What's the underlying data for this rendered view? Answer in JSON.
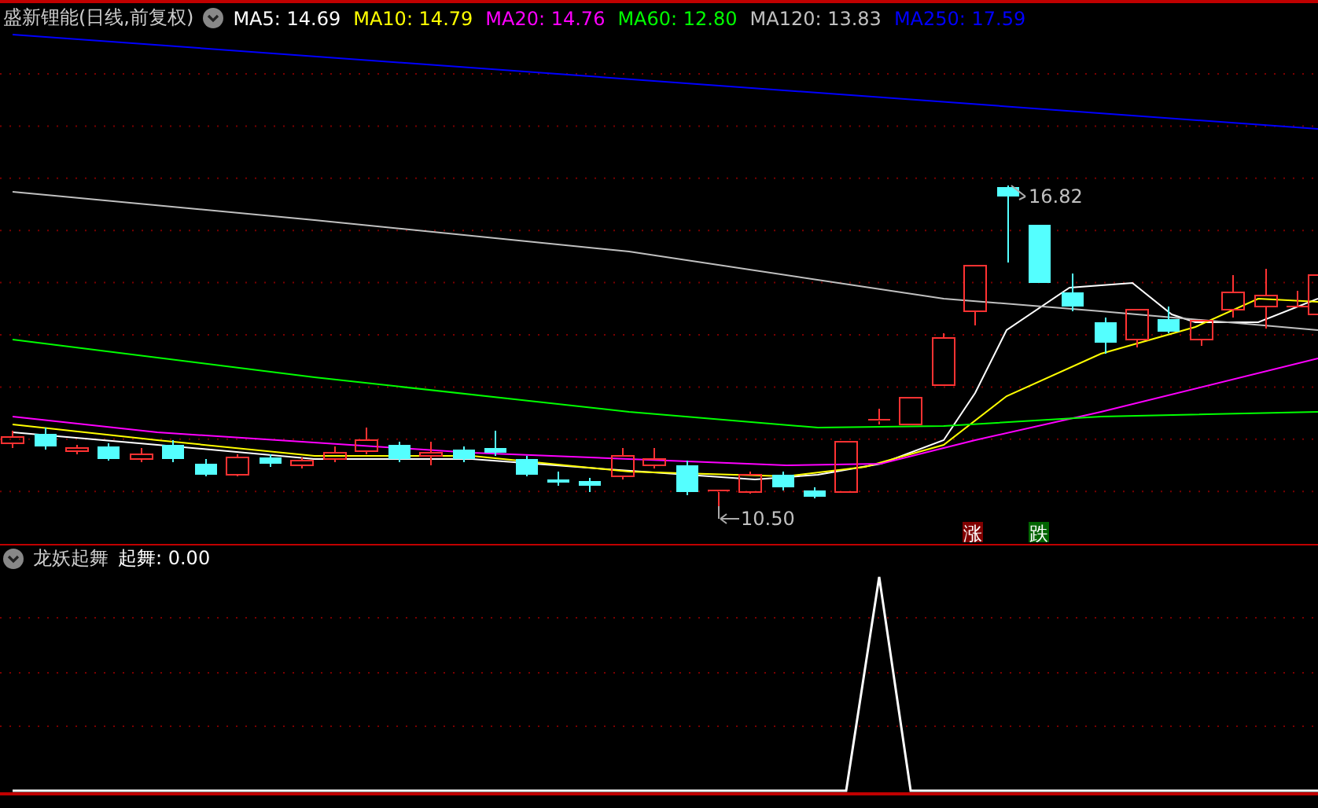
{
  "header": {
    "title": "盛新锂能(日线,前复权)",
    "ma_values": [
      {
        "label": "MA5: 14.69",
        "color": "#ffffff"
      },
      {
        "label": "MA10: 14.79",
        "color": "#ffff00"
      },
      {
        "label": "MA20: 14.76",
        "color": "#ff00ff"
      },
      {
        "label": "MA60: 12.80",
        "color": "#00ff00"
      },
      {
        "label": "MA120: 13.83",
        "color": "#c0c0c0"
      },
      {
        "label": "MA250: 17.59",
        "color": "#0000ff"
      }
    ]
  },
  "price_chart": {
    "high_label": "16.82",
    "low_label": "10.50",
    "markers": [
      {
        "text": "涨",
        "kind": "rise"
      },
      {
        "text": "跌",
        "kind": "fall"
      }
    ]
  },
  "indicator": {
    "title": "龙妖起舞",
    "value_label": "起舞: 0.00"
  }
}
